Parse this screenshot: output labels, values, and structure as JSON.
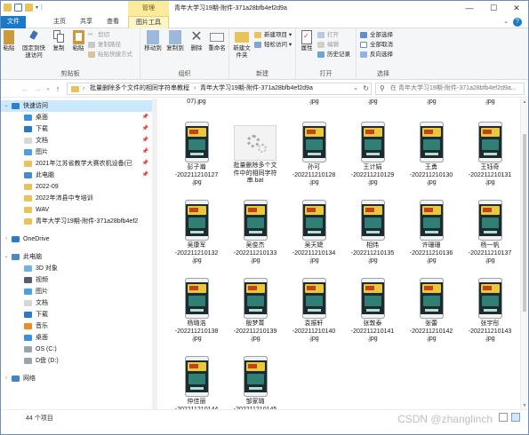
{
  "window": {
    "title": "青年大学习19期-附件-371a28bfb4ef2d9a",
    "context_tab_header": "管理",
    "controls": [
      "—",
      "☐",
      "✕"
    ]
  },
  "tabs": [
    {
      "label": "文件"
    },
    {
      "label": "主页"
    },
    {
      "label": "共享"
    },
    {
      "label": "查看"
    },
    {
      "label": "图片工具"
    }
  ],
  "ribbon": {
    "clipboard": {
      "label": "剪贴板",
      "paste_label": "粘贴",
      "pin_label": "固定到快速访问",
      "copy_label": "复制",
      "cut_label": "剪切",
      "copy_path_label": "复制路径",
      "paste_shortcut_label": "粘贴快捷方式"
    },
    "organize": {
      "label": "组织",
      "move_label": "移动到",
      "copy_to_label": "复制到",
      "delete_label": "删除",
      "rename_label": "重命名"
    },
    "new": {
      "label": "新建",
      "new_folder_label": "新建文件夹",
      "new_item_label": "新建项目",
      "easy_access_label": "轻松访问"
    },
    "open": {
      "label": "打开",
      "properties_label": "属性",
      "open_label": "打开",
      "edit_label": "编辑",
      "history_label": "历史记录"
    },
    "select": {
      "label": "选择",
      "select_all_label": "全部选择",
      "select_none_label": "全部取消",
      "invert_label": "反向选择"
    }
  },
  "address": {
    "crumbs": [
      "批量删除多个文件的相同字符串教程",
      "青年大学习19期-附件-371a28bfb4ef2d9a"
    ],
    "search_placeholder": "在 青年大学习19期-附件-371a28bfb4ef2d9a..."
  },
  "nav": {
    "items": [
      {
        "label": "快速访问",
        "icon": "star-icon",
        "expanded": true,
        "selected": true
      },
      {
        "label": "桌面",
        "icon": "desktop-icon",
        "pinned": true
      },
      {
        "label": "下载",
        "icon": "download-icon",
        "pinned": true
      },
      {
        "label": "文档",
        "icon": "document-icon",
        "pinned": true
      },
      {
        "label": "图片",
        "icon": "picture-icon",
        "pinned": true
      },
      {
        "label": "2021年江苏省教学大赛农机设备(已",
        "icon": "folder-icon",
        "pinned": true
      },
      {
        "label": "此电脑",
        "icon": "computer-icon",
        "pinned": true
      },
      {
        "label": "2022-09",
        "icon": "folder-icon"
      },
      {
        "label": "2022年沛县中专培训",
        "icon": "folder-icon"
      },
      {
        "label": "WAV",
        "icon": "folder-icon"
      },
      {
        "label": "青年大学习19期-附件-371a28bfb4ef2",
        "icon": "folder-icon"
      },
      {
        "label": "OneDrive",
        "icon": "onedrive-icon"
      },
      {
        "label": "此电脑",
        "icon": "computer-icon",
        "expanded": true
      },
      {
        "label": "3D 对象",
        "icon": "3d-objects-icon"
      },
      {
        "label": "视频",
        "icon": "video-icon"
      },
      {
        "label": "图片",
        "icon": "picture-icon"
      },
      {
        "label": "文档",
        "icon": "document-icon"
      },
      {
        "label": "下载",
        "icon": "download-icon"
      },
      {
        "label": "音乐",
        "icon": "music-icon"
      },
      {
        "label": "桌面",
        "icon": "desktop-icon"
      },
      {
        "label": "OS (C:)",
        "icon": "drive-icon"
      },
      {
        "label": "D盘 (D:)",
        "icon": "drive-icon"
      },
      {
        "label": "网络",
        "icon": "network-icon"
      }
    ]
  },
  "files": [
    {
      "line1": "07).jpg",
      "line2": "",
      "line3": "",
      "partial": true
    },
    {
      "line1": "",
      "line2": "",
      "line3": "",
      "partial": true,
      "type": "blank"
    },
    {
      "line1": ".jpg",
      "line2": "",
      "line3": "",
      "partial": true
    },
    {
      "line1": ".jpg",
      "line2": "",
      "line3": "",
      "partial": true
    },
    {
      "line1": ".jpg",
      "line2": "",
      "line3": "",
      "partial": true
    },
    {
      "line1": ".jpg",
      "line2": "",
      "line3": "",
      "partial": true
    },
    {
      "line1": "彭子瀚",
      "line2": "-202211210127",
      "line3": ".jpg"
    },
    {
      "line1": "批量删除多个文",
      "line2": "件中的相同字符",
      "line3": "串.bat",
      "type": "bat"
    },
    {
      "line1": "孙可",
      "line2": "-202211210128",
      "line3": ".jpg"
    },
    {
      "line1": "王计娟",
      "line2": "-202211210129",
      "line3": ".jpg"
    },
    {
      "line1": "王勇",
      "line2": "-202211210130",
      "line3": ".jpg"
    },
    {
      "line1": "王钰奇",
      "line2": "-202211210131",
      "line3": ".jpg"
    },
    {
      "line1": "吴康军",
      "line2": "-202211210132",
      "line3": ".jpg"
    },
    {
      "line1": "吴俊杰",
      "line2": "-202211210133",
      "line3": ".jpg"
    },
    {
      "line1": "吴天婕",
      "line2": "-202211210134",
      "line3": ".jpg"
    },
    {
      "line1": "相炜",
      "line2": "-202211210135",
      "line3": ".jpg"
    },
    {
      "line1": "许珊珊",
      "line2": "-202211210136",
      "line3": ".jpg"
    },
    {
      "line1": "杨一帆",
      "line2": "-202211210137",
      "line3": ".jpg"
    },
    {
      "line1": "杨璐浩",
      "line2": "-202211210138",
      "line3": ".jpg"
    },
    {
      "line1": "殷梦菁",
      "line2": "-202211210139",
      "line3": ".jpg"
    },
    {
      "line1": "袁振轩",
      "line2": "-202211210140",
      "line3": ".jpg"
    },
    {
      "line1": "张敦泰",
      "line2": "-202211210141",
      "line3": ".jpg"
    },
    {
      "line1": "张蕾",
      "line2": "-202211210142",
      "line3": ".jpg"
    },
    {
      "line1": "张宇彤",
      "line2": "-202211210143",
      "line3": ".jpg"
    },
    {
      "line1": "仲佳丽",
      "line2": "-202211210144",
      "line3": ".jpg"
    },
    {
      "line1": "邹家璐",
      "line2": "-202211210145",
      "line3": ".jpg"
    }
  ],
  "status": {
    "count_text": "44 个项目"
  },
  "watermark": "CSDN @zhanglinch",
  "colors": {
    "accent": "#1979ca",
    "context_tab": "#fbeb9b",
    "selection": "#cce8ff"
  }
}
